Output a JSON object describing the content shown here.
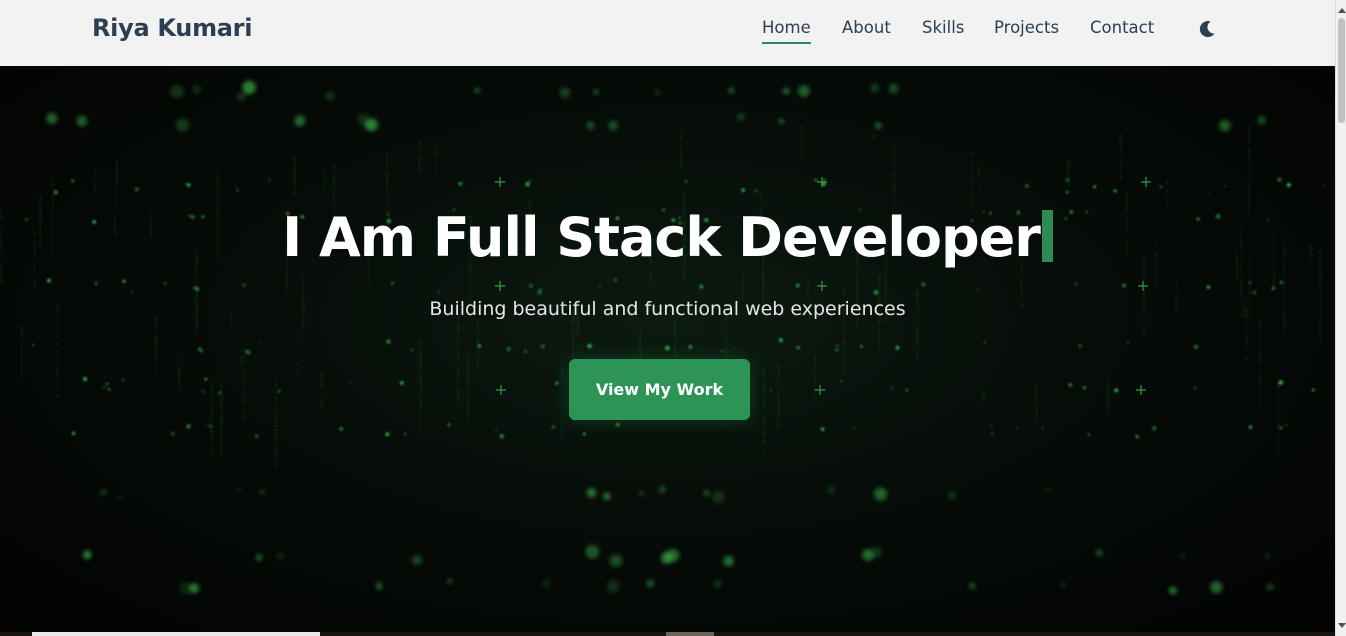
{
  "brand": {
    "name": "Riya Kumari"
  },
  "nav": {
    "items": [
      {
        "label": "Home",
        "active": true
      },
      {
        "label": "About",
        "active": false
      },
      {
        "label": "Skills",
        "active": false
      },
      {
        "label": "Projects",
        "active": false
      },
      {
        "label": "Contact",
        "active": false
      }
    ],
    "theme_toggle_icon": "moon-icon"
  },
  "hero": {
    "title": "I Am Full Stack Developer",
    "subtitle": "Building beautiful and functional web experiences",
    "cta_label": "View My Work"
  },
  "colors": {
    "accent": "#2e8b57",
    "button": "#2e9455",
    "nav_text": "#2c3e50",
    "matrix_green": "#3fbf4f",
    "hero_bg": "#020302"
  }
}
